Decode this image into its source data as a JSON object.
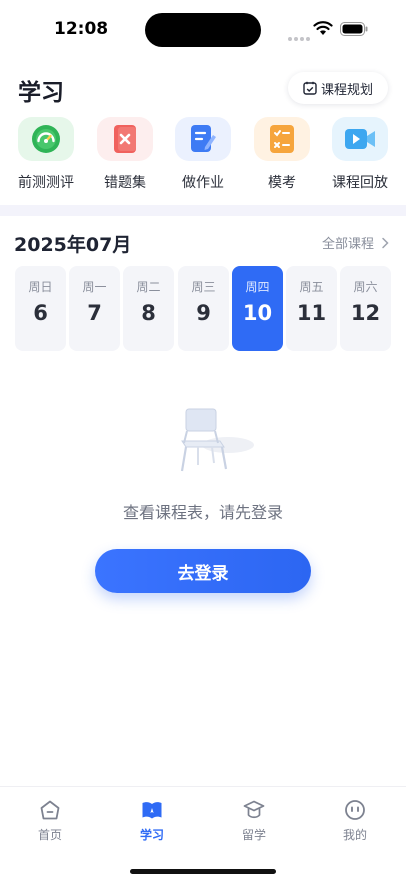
{
  "status_bar": {
    "time": "12:08"
  },
  "header": {
    "title": "学习",
    "plan_button_label": "课程规划"
  },
  "quick_actions": [
    {
      "label": "前测测评",
      "icon": "gauge-icon",
      "color": "#33b85c"
    },
    {
      "label": "错题集",
      "icon": "wrong-questions-icon",
      "color": "#ee5a58"
    },
    {
      "label": "做作业",
      "icon": "homework-icon",
      "color": "#3e7bf4"
    },
    {
      "label": "模考",
      "icon": "mock-exam-icon",
      "color": "#f6a53c"
    },
    {
      "label": "课程回放",
      "icon": "video-playback-icon",
      "color": "#3da7f0"
    }
  ],
  "calendar": {
    "month_title": "2025年07月",
    "all_courses_label": "全部课程",
    "days": [
      {
        "weekday": "周日",
        "date": "6"
      },
      {
        "weekday": "周一",
        "date": "7"
      },
      {
        "weekday": "周二",
        "date": "8"
      },
      {
        "weekday": "周三",
        "date": "9"
      },
      {
        "weekday": "周四",
        "date": "10",
        "selected": true
      },
      {
        "weekday": "周五",
        "date": "11"
      },
      {
        "weekday": "周六",
        "date": "12"
      }
    ]
  },
  "empty_state": {
    "message": "查看课程表，请先登录",
    "login_button_label": "去登录"
  },
  "tab_bar": {
    "items": [
      {
        "label": "首页",
        "icon": "home-icon"
      },
      {
        "label": "学习",
        "icon": "book-icon",
        "active": true
      },
      {
        "label": "留学",
        "icon": "graduation-cap-icon"
      },
      {
        "label": "我的",
        "icon": "profile-face-icon"
      }
    ]
  },
  "colors": {
    "accent": "#2f6bf5",
    "divider": "#f3f3fb",
    "day_cell_bg": "#f4f5f9"
  }
}
